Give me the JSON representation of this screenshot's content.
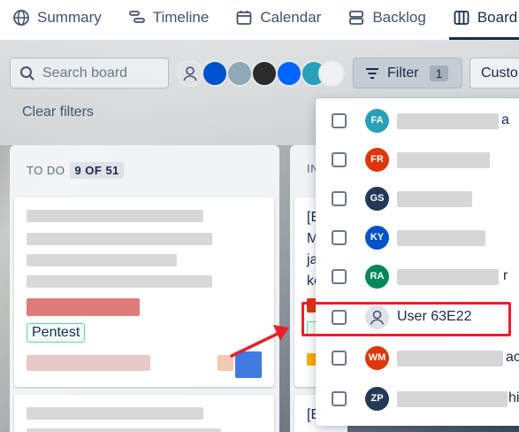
{
  "nav": {
    "tabs": [
      {
        "label": "Summary",
        "icon": "globe-icon"
      },
      {
        "label": "Timeline",
        "icon": "timeline-icon"
      },
      {
        "label": "Calendar",
        "icon": "calendar-icon"
      },
      {
        "label": "Backlog",
        "icon": "backlog-icon"
      },
      {
        "label": "Board",
        "icon": "board-icon",
        "active": true
      }
    ]
  },
  "toolbar": {
    "search_placeholder": "Search board",
    "filter_label": "Filter",
    "filter_count": "1",
    "custom_label": "Custo",
    "clear_filters": "Clear filters"
  },
  "columns": {
    "todo": {
      "title": "TO DO",
      "count": "9 OF 51"
    },
    "in_progress": {
      "title_partial": "IN"
    }
  },
  "cards": {
    "label_tag": "Pentest"
  },
  "in_progress_snippets": [
    "[E",
    "M",
    "ja",
    "ke",
    "[E"
  ],
  "filter_dropdown": {
    "options": [
      {
        "initials": "FA",
        "color": "#2aa0b8",
        "name_visible": "a"
      },
      {
        "initials": "FR",
        "color": "#de350b",
        "name_visible": ""
      },
      {
        "initials": "GS",
        "color": "#253858",
        "name_visible": ""
      },
      {
        "initials": "KY",
        "color": "#0052cc",
        "name_visible": ""
      },
      {
        "initials": "RA",
        "color": "#00875a",
        "name_visible": "r"
      },
      {
        "initials": "",
        "color": "#dfe1e6",
        "name": "User 63E22",
        "highlighted": true
      },
      {
        "initials": "WM",
        "color": "#de350b",
        "name_visible": "ac"
      },
      {
        "initials": "ZP",
        "color": "#253858",
        "name_visible": "hi"
      }
    ]
  },
  "colors": {
    "highlight": "#e8202a",
    "arrow": "#e8202a"
  }
}
